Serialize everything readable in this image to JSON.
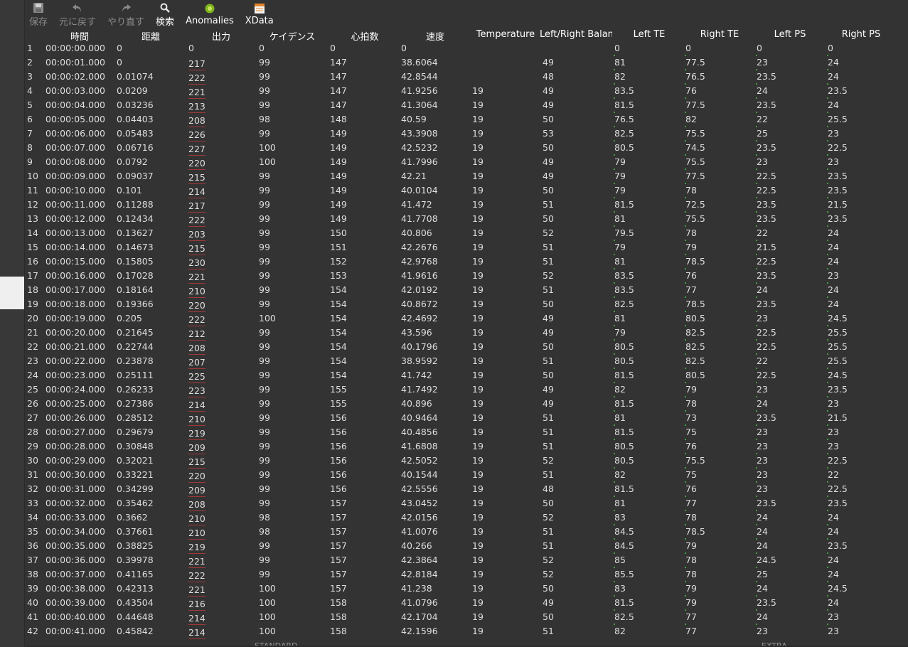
{
  "toolbar": {
    "save_label": "保存",
    "undo_label": "元に戻す",
    "redo_label": "やり直す",
    "search_label": "検索",
    "anomalies_label": "Anomalies",
    "xdata_label": "XData"
  },
  "table": {
    "columns": [
      "",
      "時間",
      "距離",
      "出力",
      "ケイデンス",
      "心拍数",
      "速度",
      "Temperature",
      "Left/Right Balanc",
      "Left TE",
      "Right TE",
      "Left PS",
      "Right PS"
    ],
    "rows": [
      [
        "1",
        "00:00:00.000",
        "0",
        "0",
        "0",
        "0",
        "0",
        "",
        "",
        "0",
        "0",
        "0",
        "0"
      ],
      [
        "2",
        "00:00:01.000",
        "0",
        "217",
        "99",
        "147",
        "38.6064",
        "",
        "49",
        "81",
        "77.5",
        "23",
        "24"
      ],
      [
        "3",
        "00:00:02.000",
        "0.01074",
        "222",
        "99",
        "147",
        "42.8544",
        "",
        "48",
        "82",
        "76.5",
        "23.5",
        "24"
      ],
      [
        "4",
        "00:00:03.000",
        "0.0209",
        "221",
        "99",
        "147",
        "41.9256",
        "19",
        "49",
        "83.5",
        "76",
        "24",
        "23.5"
      ],
      [
        "5",
        "00:00:04.000",
        "0.03236",
        "213",
        "99",
        "147",
        "41.3064",
        "19",
        "49",
        "81.5",
        "77.5",
        "23.5",
        "24"
      ],
      [
        "6",
        "00:00:05.000",
        "0.04403",
        "208",
        "98",
        "148",
        "40.59",
        "19",
        "50",
        "76.5",
        "82",
        "22",
        "25.5"
      ],
      [
        "7",
        "00:00:06.000",
        "0.05483",
        "226",
        "99",
        "149",
        "43.3908",
        "19",
        "53",
        "82.5",
        "75.5",
        "25",
        "23"
      ],
      [
        "8",
        "00:00:07.000",
        "0.06716",
        "227",
        "100",
        "149",
        "42.5232",
        "19",
        "50",
        "80.5",
        "74.5",
        "23.5",
        "22.5"
      ],
      [
        "9",
        "00:00:08.000",
        "0.0792",
        "220",
        "100",
        "149",
        "41.7996",
        "19",
        "49",
        "79",
        "75.5",
        "23",
        "23"
      ],
      [
        "10",
        "00:00:09.000",
        "0.09037",
        "215",
        "99",
        "149",
        "42.21",
        "19",
        "49",
        "79",
        "77.5",
        "22.5",
        "23.5"
      ],
      [
        "11",
        "00:00:10.000",
        "0.101",
        "214",
        "99",
        "149",
        "40.0104",
        "19",
        "50",
        "79",
        "78",
        "22.5",
        "23.5"
      ],
      [
        "12",
        "00:00:11.000",
        "0.11288",
        "217",
        "99",
        "149",
        "41.472",
        "19",
        "51",
        "81.5",
        "72.5",
        "23.5",
        "21.5"
      ],
      [
        "13",
        "00:00:12.000",
        "0.12434",
        "222",
        "99",
        "149",
        "41.7708",
        "19",
        "50",
        "81",
        "75.5",
        "23.5",
        "23.5"
      ],
      [
        "14",
        "00:00:13.000",
        "0.13627",
        "203",
        "99",
        "150",
        "40.806",
        "19",
        "52",
        "79.5",
        "78",
        "22",
        "24"
      ],
      [
        "15",
        "00:00:14.000",
        "0.14673",
        "215",
        "99",
        "151",
        "42.2676",
        "19",
        "51",
        "79",
        "79",
        "21.5",
        "24"
      ],
      [
        "16",
        "00:00:15.000",
        "0.15805",
        "230",
        "99",
        "152",
        "42.9768",
        "19",
        "51",
        "81",
        "78.5",
        "22.5",
        "24"
      ],
      [
        "17",
        "00:00:16.000",
        "0.17028",
        "221",
        "99",
        "153",
        "41.9616",
        "19",
        "52",
        "83.5",
        "76",
        "23.5",
        "23"
      ],
      [
        "18",
        "00:00:17.000",
        "0.18164",
        "210",
        "99",
        "154",
        "42.0192",
        "19",
        "51",
        "83.5",
        "77",
        "24",
        "24"
      ],
      [
        "19",
        "00:00:18.000",
        "0.19366",
        "220",
        "99",
        "154",
        "40.8672",
        "19",
        "50",
        "82.5",
        "78.5",
        "23.5",
        "24"
      ],
      [
        "20",
        "00:00:19.000",
        "0.205",
        "222",
        "100",
        "154",
        "42.4692",
        "19",
        "49",
        "81",
        "80.5",
        "23",
        "24.5"
      ],
      [
        "21",
        "00:00:20.000",
        "0.21645",
        "212",
        "99",
        "154",
        "43.596",
        "19",
        "49",
        "79",
        "82.5",
        "22.5",
        "25.5"
      ],
      [
        "22",
        "00:00:21.000",
        "0.22744",
        "208",
        "99",
        "154",
        "40.1796",
        "19",
        "50",
        "80.5",
        "82.5",
        "22.5",
        "25.5"
      ],
      [
        "23",
        "00:00:22.000",
        "0.23878",
        "207",
        "99",
        "154",
        "38.9592",
        "19",
        "51",
        "80.5",
        "82.5",
        "22",
        "25.5"
      ],
      [
        "24",
        "00:00:23.000",
        "0.25111",
        "225",
        "99",
        "154",
        "41.742",
        "19",
        "50",
        "81.5",
        "80.5",
        "22.5",
        "24.5"
      ],
      [
        "25",
        "00:00:24.000",
        "0.26233",
        "223",
        "99",
        "155",
        "41.7492",
        "19",
        "49",
        "82",
        "79",
        "23",
        "23.5"
      ],
      [
        "26",
        "00:00:25.000",
        "0.27386",
        "214",
        "99",
        "155",
        "40.896",
        "19",
        "49",
        "81.5",
        "78",
        "24",
        "23"
      ],
      [
        "27",
        "00:00:26.000",
        "0.28512",
        "210",
        "99",
        "156",
        "40.9464",
        "19",
        "51",
        "81",
        "73",
        "23.5",
        "21.5"
      ],
      [
        "28",
        "00:00:27.000",
        "0.29679",
        "219",
        "99",
        "156",
        "40.4856",
        "19",
        "51",
        "81.5",
        "75",
        "23",
        "23"
      ],
      [
        "29",
        "00:00:28.000",
        "0.30848",
        "209",
        "99",
        "156",
        "41.6808",
        "19",
        "51",
        "80.5",
        "76",
        "23",
        "23"
      ],
      [
        "30",
        "00:00:29.000",
        "0.32021",
        "215",
        "99",
        "156",
        "42.5052",
        "19",
        "52",
        "80.5",
        "75.5",
        "23",
        "22.5"
      ],
      [
        "31",
        "00:00:30.000",
        "0.33221",
        "220",
        "99",
        "156",
        "40.1544",
        "19",
        "51",
        "82",
        "75",
        "23",
        "22"
      ],
      [
        "32",
        "00:00:31.000",
        "0.34299",
        "209",
        "99",
        "156",
        "42.5556",
        "19",
        "48",
        "81.5",
        "76",
        "23",
        "22.5"
      ],
      [
        "33",
        "00:00:32.000",
        "0.35462",
        "208",
        "99",
        "157",
        "43.0452",
        "19",
        "50",
        "81",
        "77",
        "23.5",
        "23.5"
      ],
      [
        "34",
        "00:00:33.000",
        "0.3662",
        "210",
        "98",
        "157",
        "42.0156",
        "19",
        "52",
        "83",
        "78",
        "24",
        "24"
      ],
      [
        "35",
        "00:00:34.000",
        "0.37661",
        "210",
        "98",
        "157",
        "41.0076",
        "19",
        "51",
        "84.5",
        "78.5",
        "24",
        "24"
      ],
      [
        "36",
        "00:00:35.000",
        "0.38825",
        "219",
        "99",
        "157",
        "40.266",
        "19",
        "51",
        "84.5",
        "79",
        "24",
        "23.5"
      ],
      [
        "37",
        "00:00:36.000",
        "0.39978",
        "221",
        "99",
        "157",
        "42.3864",
        "19",
        "52",
        "85",
        "78",
        "24.5",
        "24"
      ],
      [
        "38",
        "00:00:37.000",
        "0.41165",
        "222",
        "99",
        "157",
        "42.8184",
        "19",
        "52",
        "85.5",
        "78",
        "25",
        "24"
      ],
      [
        "39",
        "00:00:38.000",
        "0.42313",
        "221",
        "100",
        "157",
        "41.238",
        "19",
        "50",
        "83",
        "79",
        "24",
        "24.5"
      ],
      [
        "40",
        "00:00:39.000",
        "0.43504",
        "216",
        "100",
        "158",
        "41.0796",
        "19",
        "49",
        "81.5",
        "79",
        "23.5",
        "24"
      ],
      [
        "41",
        "00:00:40.000",
        "0.44648",
        "214",
        "100",
        "158",
        "42.1704",
        "19",
        "50",
        "82.5",
        "77",
        "24",
        "23"
      ],
      [
        "42",
        "00:00:41.000",
        "0.45842",
        "214",
        "100",
        "158",
        "42.1596",
        "19",
        "51",
        "82",
        "77",
        "23",
        "23"
      ]
    ]
  },
  "footer": {
    "left_label": "STANDARD",
    "right_label": "EXTRA"
  }
}
